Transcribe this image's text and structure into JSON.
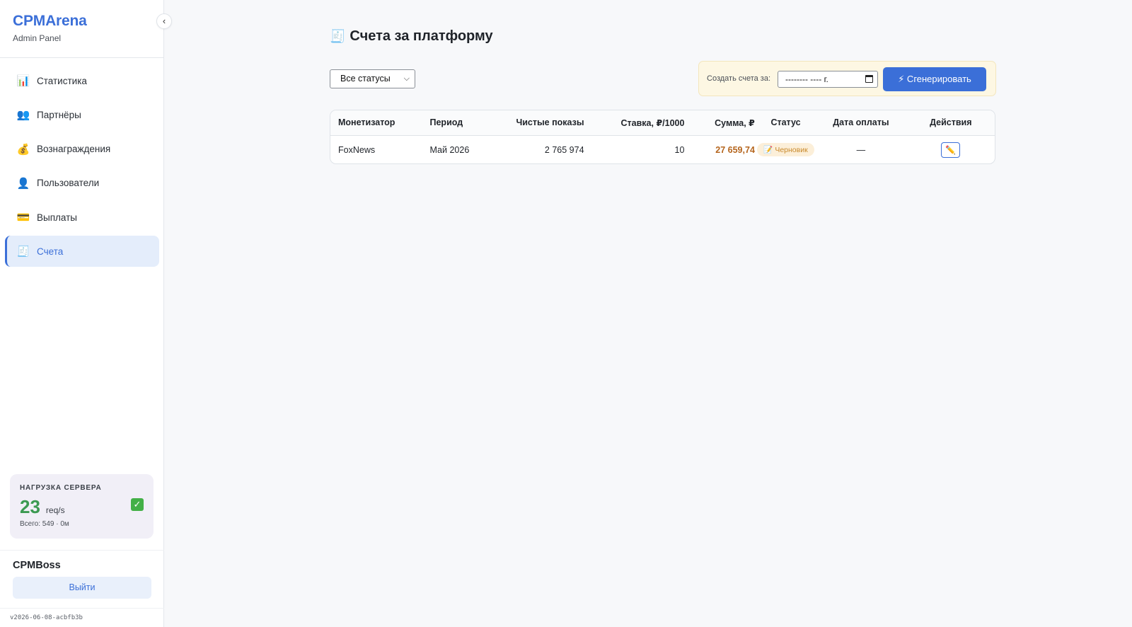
{
  "sidebar": {
    "brand_title": "CPMArena",
    "brand_subtitle": "Admin Panel",
    "collapse_glyph": "‹",
    "items": [
      {
        "label": "Статистика",
        "icon": "📊",
        "icon_name": "chart-icon",
        "active": false
      },
      {
        "label": "Партнёры",
        "icon": "👥",
        "icon_name": "partners-icon",
        "active": false
      },
      {
        "label": "Вознаграждения",
        "icon": "💰",
        "icon_name": "money-bag-icon",
        "active": false
      },
      {
        "label": "Пользователи",
        "icon": "👤",
        "icon_name": "user-icon",
        "active": false
      },
      {
        "label": "Выплаты",
        "icon": "💳",
        "icon_name": "card-icon",
        "active": false
      },
      {
        "label": "Счета",
        "icon": "🧾",
        "icon_name": "receipt-icon",
        "active": true
      }
    ],
    "server_load": {
      "title": "НАГРУЗКА СЕРВЕРА",
      "value": "23",
      "unit": "req/s",
      "total": "Всего: 549 · 0м",
      "status_icon": "✓"
    },
    "user": {
      "name": "CPMBoss",
      "logout_label": "Выйти"
    },
    "version": "v2026-06-08-acbfb3b"
  },
  "main": {
    "title": "Счета за платформу",
    "title_icon": "🧾",
    "filter": {
      "selected": "Все статусы",
      "chevron": "⌵"
    },
    "generate": {
      "label": "Создать счета за:",
      "date_value": "-------- ---- г.",
      "button_label": "⚡ Сгенерировать"
    },
    "table": {
      "columns": [
        "Монетизатор",
        "Период",
        "Чистые показы",
        "Ставка, ₽/1000",
        "Сумма, ₽",
        "Статус",
        "Дата оплаты",
        "Действия"
      ],
      "rows": [
        {
          "monetizer": "FoxNews",
          "period": "Май 2026",
          "impressions": "2 765 974",
          "rate": "10",
          "amount": "27 659,74",
          "status": "📝 Черновик",
          "paid_date": "—",
          "action_icon": "✏️"
        }
      ]
    }
  },
  "colors": {
    "accent": "#3b6fd8",
    "amount": "#b5651d",
    "status_draft_bg": "#fcefd9",
    "status_draft_text": "#c98a2c",
    "load_value": "#3c9a52",
    "generate_panel_bg": "#fdf7e3"
  }
}
